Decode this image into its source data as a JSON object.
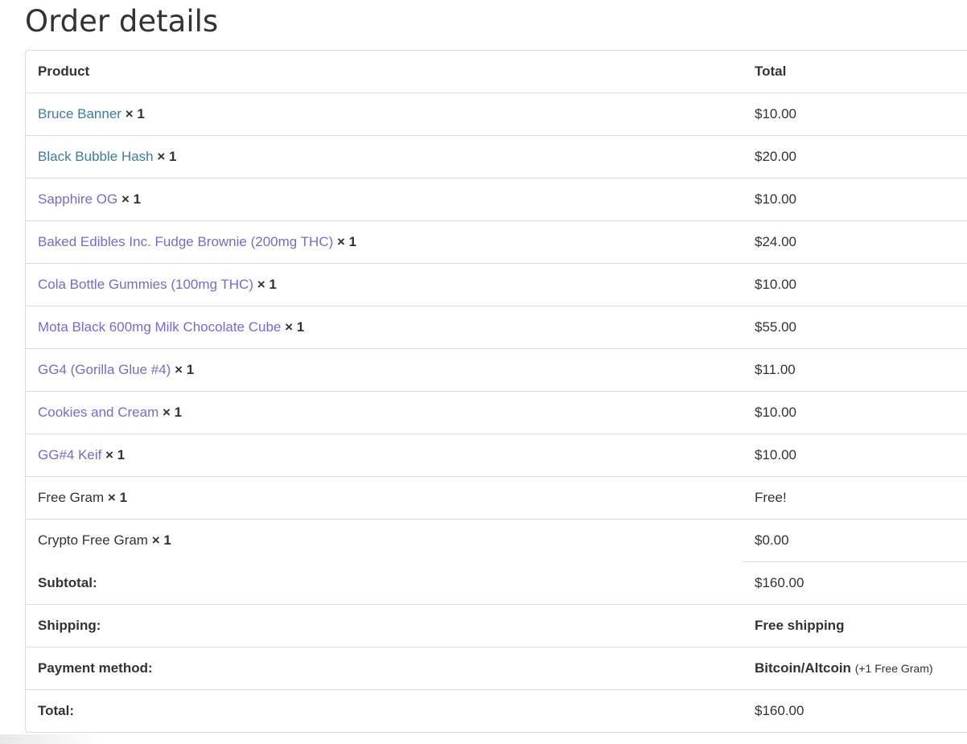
{
  "page": {
    "title": "Order details"
  },
  "table": {
    "headers": {
      "product": "Product",
      "total": "Total"
    },
    "items": [
      {
        "name": "Bruce Banner",
        "qty": "× 1",
        "total": "$10.00",
        "link": "unvisited"
      },
      {
        "name": "Black Bubble Hash",
        "qty": "× 1",
        "total": "$20.00",
        "link": "unvisited"
      },
      {
        "name": "Sapphire OG",
        "qty": "× 1",
        "total": "$10.00",
        "link": "visited"
      },
      {
        "name": "Baked Edibles Inc. Fudge Brownie (200mg THC)",
        "qty": "× 1",
        "total": "$24.00",
        "link": "visited"
      },
      {
        "name": "Cola Bottle Gummies (100mg THC)",
        "qty": "× 1",
        "total": "$10.00",
        "link": "visited"
      },
      {
        "name": "Mota Black 600mg Milk Chocolate Cube",
        "qty": "× 1",
        "total": "$55.00",
        "link": "visited"
      },
      {
        "name": "GG4 (Gorilla Glue #4)",
        "qty": "× 1",
        "total": "$11.00",
        "link": "visited"
      },
      {
        "name": "Cookies and Cream",
        "qty": "× 1",
        "total": "$10.00",
        "link": "visited"
      },
      {
        "name": "GG#4 Keif",
        "qty": "× 1",
        "total": "$10.00",
        "link": "visited"
      },
      {
        "name": "Free Gram",
        "qty": "× 1",
        "total": "Free!",
        "link": "none"
      },
      {
        "name": "Crypto Free Gram",
        "qty": "× 1",
        "total": "$0.00",
        "link": "none"
      }
    ],
    "summary": {
      "subtotal_label": "Subtotal:",
      "subtotal_value": "$160.00",
      "shipping_label": "Shipping:",
      "shipping_value": "Free shipping",
      "payment_label": "Payment method:",
      "payment_value": "Bitcoin/Altcoin",
      "payment_note": "(+1 Free Gram)",
      "total_label": "Total:",
      "total_value": "$160.00"
    }
  },
  "colors": {
    "link_visited": "#7b68d6",
    "link_unvisited": "#3d7aa8",
    "text": "#333333",
    "border": "#dddddd"
  }
}
